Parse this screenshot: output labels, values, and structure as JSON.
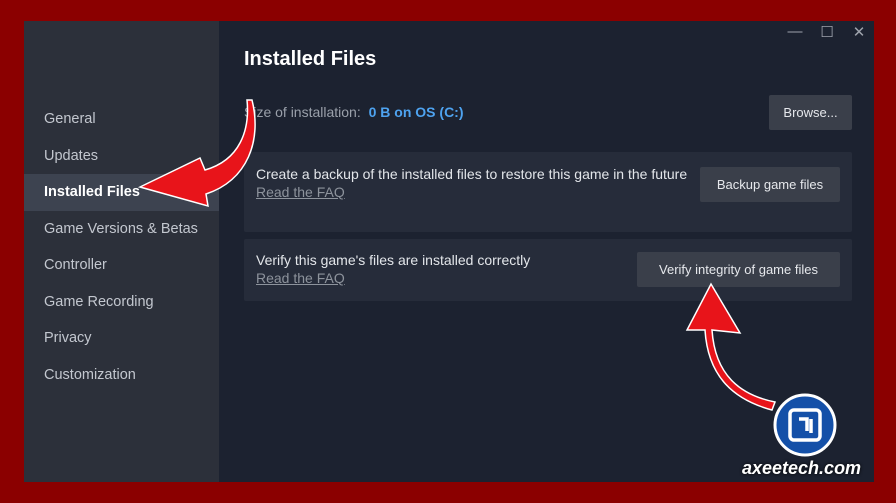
{
  "window": {
    "controls": {
      "minimize": "—",
      "maximize": "☐",
      "close": "✕"
    }
  },
  "sidebar": {
    "items": [
      {
        "label": "General"
      },
      {
        "label": "Updates"
      },
      {
        "label": "Installed Files"
      },
      {
        "label": "Game Versions & Betas"
      },
      {
        "label": "Controller"
      },
      {
        "label": "Game Recording"
      },
      {
        "label": "Privacy"
      },
      {
        "label": "Customization"
      }
    ],
    "active_index": 2
  },
  "main": {
    "title": "Installed Files",
    "size_label": "Size of installation:",
    "size_value": "0 B on OS (C:)",
    "browse_label": "Browse...",
    "backup_card": {
      "text": "Create a backup of the installed files to restore this game in the future",
      "link": "Read the FAQ",
      "button": "Backup game files"
    },
    "verify_card": {
      "text": "Verify this game's files are installed correctly",
      "link": "Read the FAQ",
      "button": "Verify integrity of game files"
    }
  },
  "watermark": {
    "text": "axeetech.com"
  },
  "colors": {
    "frame": "#8b0000",
    "window_bg": "#1c2230",
    "sidebar_bg": "#2c303a",
    "accent_blue": "#4ea3f0",
    "annotation_arrow": "#e8141a"
  }
}
